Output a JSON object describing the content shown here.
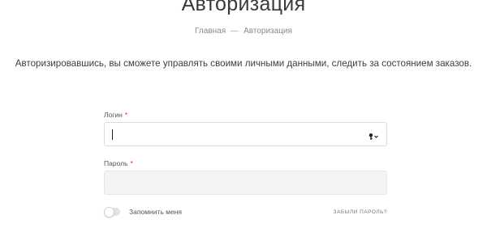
{
  "page": {
    "title": "Авторизация",
    "breadcrumb": {
      "home": "Главная",
      "separator": "—",
      "current": "Авторизация"
    },
    "intro": "Авторизировавшись, вы сможете управлять своими личными данными, следить за состоянием заказов."
  },
  "form": {
    "login": {
      "label": "Логин",
      "required_mark": "*",
      "value": "",
      "trailing_icon": "key-dropdown-icon"
    },
    "password": {
      "label": "Пароль",
      "required_mark": "*",
      "value": ""
    },
    "remember": {
      "label": "Запомнить меня",
      "checked": false
    },
    "forgot_link": "Забыли пароль?"
  },
  "colors": {
    "text": "#333333",
    "muted": "#8a8a8a",
    "required": "#d0322c",
    "field_border": "#dcdcdc",
    "field_fill": "#f4f4f4"
  }
}
